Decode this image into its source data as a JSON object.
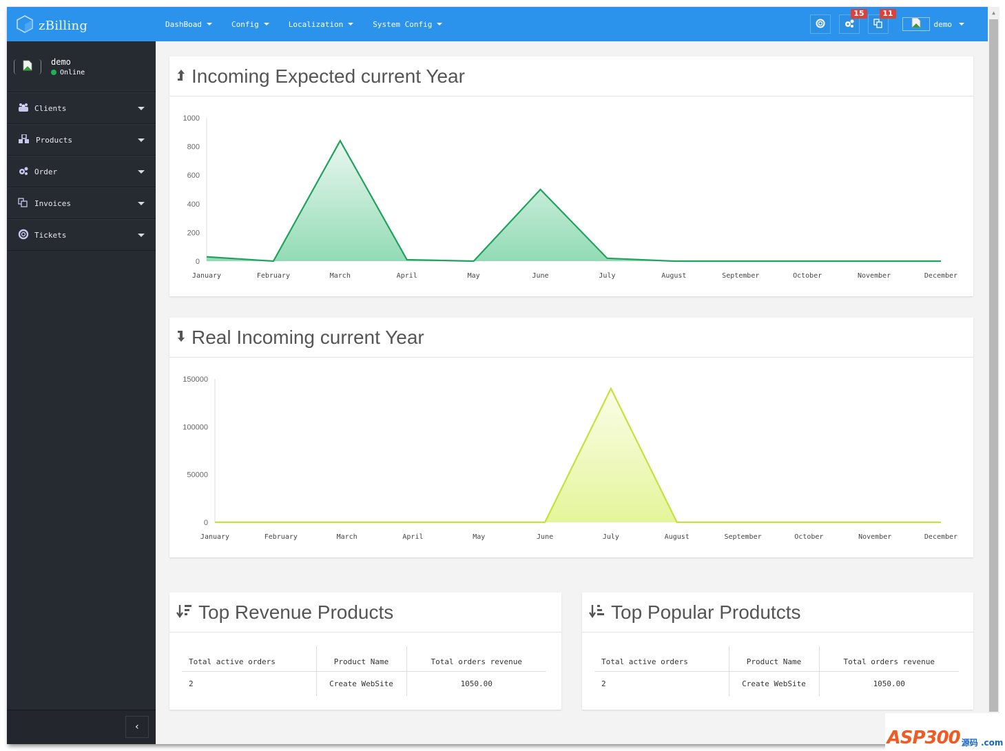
{
  "app": {
    "title": "zBilling"
  },
  "nav": {
    "items": [
      {
        "label": "DashBoad"
      },
      {
        "label": "Config"
      },
      {
        "label": "Localization"
      },
      {
        "label": "System Config"
      }
    ]
  },
  "topbar": {
    "settings_badge": "15",
    "invoices_badge": "11",
    "user_name": "demo"
  },
  "sidebar": {
    "user_name": "demo",
    "status": "Online",
    "status_color": "#22b055",
    "items": [
      {
        "label": "Clients",
        "icon": "users-icon"
      },
      {
        "label": "Products",
        "icon": "cubes-icon"
      },
      {
        "label": "Order",
        "icon": "gears-icon"
      },
      {
        "label": "Invoices",
        "icon": "copy-icon"
      },
      {
        "label": "Tickets",
        "icon": "life-ring-icon"
      }
    ],
    "collapse_label": "‹"
  },
  "panels": {
    "expected_title": "Incoming Expected current Year",
    "real_title": "Real Incoming current Year",
    "revenue_title": "Top Revenue Products",
    "popular_title": "Top Popular Produtcts"
  },
  "chart_data": [
    {
      "type": "area",
      "title": "Incoming Expected current Year",
      "categories": [
        "January",
        "February",
        "March",
        "April",
        "May",
        "June",
        "July",
        "August",
        "September",
        "October",
        "November",
        "December"
      ],
      "values": [
        30,
        0,
        840,
        10,
        0,
        500,
        20,
        0,
        0,
        0,
        0,
        0
      ],
      "yticks": [
        0,
        200,
        400,
        600,
        800,
        1000
      ],
      "ylim": [
        0,
        1000
      ],
      "color": "#1fa35b",
      "fill_top": "#eaf7f0",
      "fill_bottom": "#92dbb5",
      "grid": false
    },
    {
      "type": "area",
      "title": "Real Incoming current Year",
      "categories": [
        "January",
        "February",
        "March",
        "April",
        "May",
        "June",
        "July",
        "August",
        "September",
        "October",
        "November",
        "December"
      ],
      "values": [
        0,
        0,
        0,
        0,
        0,
        0,
        140000,
        0,
        0,
        0,
        0,
        0
      ],
      "yticks": [
        0,
        50000,
        100000,
        150000
      ],
      "ylim": [
        0,
        150000
      ],
      "color": "#c5e23a",
      "fill_top": "#fbfde8",
      "fill_bottom": "#e4f59a",
      "grid": false
    }
  ],
  "tables": {
    "revenue": {
      "headers": [
        "Total active orders",
        "Product Name",
        "Total orders revenue"
      ],
      "rows": [
        [
          "2",
          "Create WebSite",
          "1050.00"
        ]
      ]
    },
    "popular": {
      "headers": [
        "Total active orders",
        "Product Name",
        "Total orders revenue"
      ],
      "rows": [
        [
          "2",
          "Create WebSite",
          "1050.00"
        ]
      ]
    }
  },
  "watermark": {
    "text": "ASP300",
    "sub": "源码 .com"
  }
}
